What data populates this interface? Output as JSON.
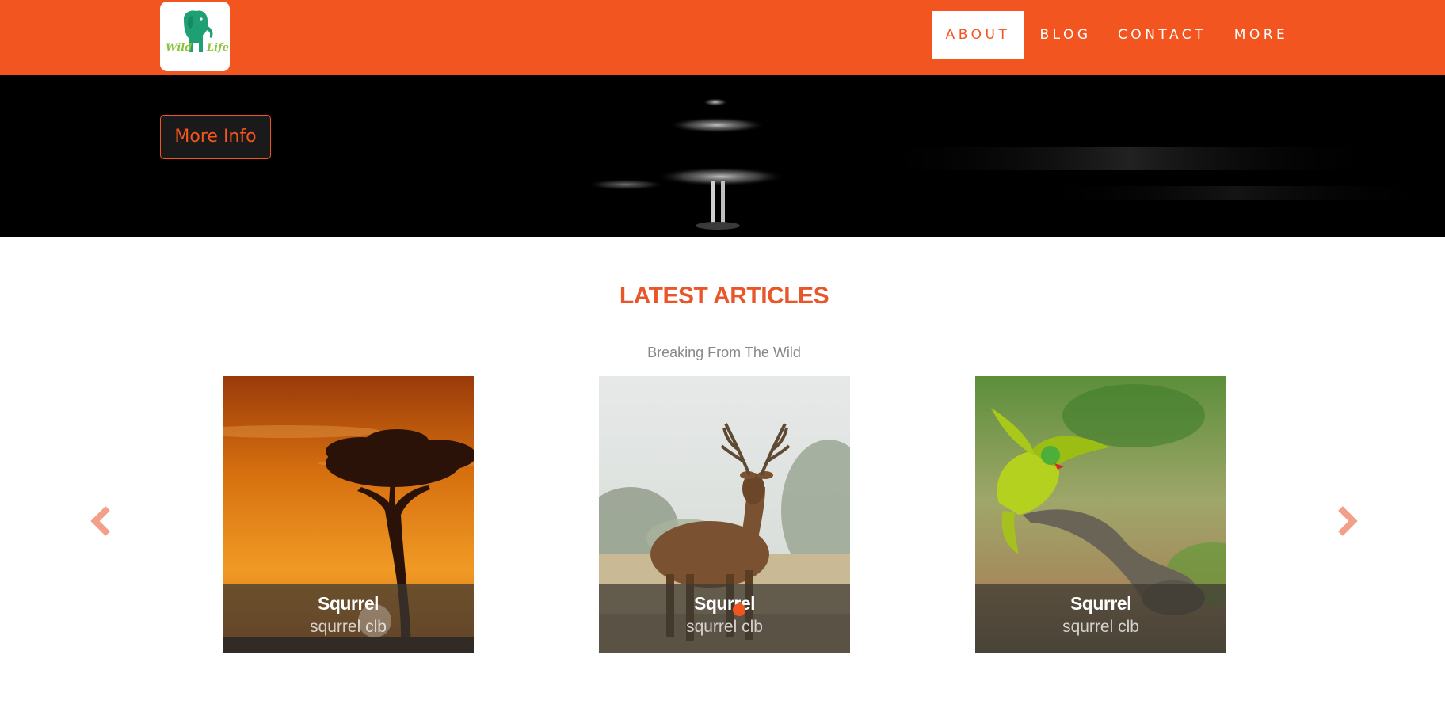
{
  "header": {
    "logo_text_left": "Wild",
    "logo_text_right": "Life",
    "nav": [
      {
        "label": "ABOUT",
        "active": true
      },
      {
        "label": "BLOG",
        "active": false
      },
      {
        "label": "CONTACT",
        "active": false
      },
      {
        "label": "MORE",
        "active": false
      }
    ]
  },
  "hero": {
    "button_label": "More Info"
  },
  "articles": {
    "title": "LATEST ARTICLES",
    "subtitle": "Breaking From The Wild",
    "prev_icon": "chevron-left-icon",
    "next_icon": "chevron-right-icon",
    "cards": [
      {
        "title": "Squrrel",
        "text": "squrrel clb",
        "image": "acacia-tree-sunset"
      },
      {
        "title": "Squrrel",
        "text": "squrrel clb",
        "image": "deer-stag"
      },
      {
        "title": "Squrrel",
        "text": "squrrel clb",
        "image": "parrot-and-lizard"
      }
    ]
  },
  "colors": {
    "accent": "#f35520",
    "hero_bg": "#000000",
    "title": "#e8562a",
    "subtitle": "#888888"
  }
}
